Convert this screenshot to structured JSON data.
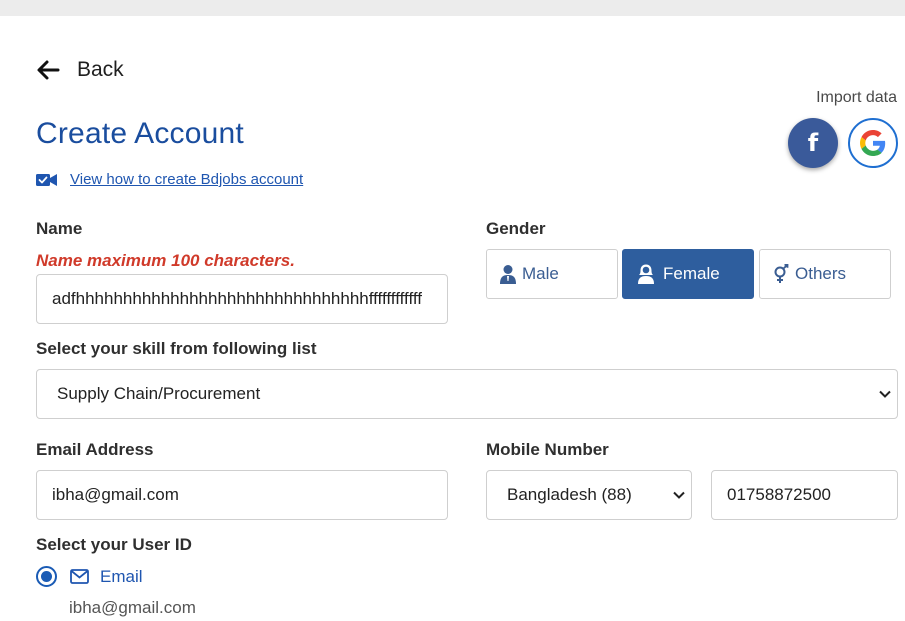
{
  "header": {
    "back_label": "Back",
    "title": "Create Account",
    "howto_link": "View how to create Bdjobs account"
  },
  "import": {
    "label": "Import data",
    "facebook_glyph": "f"
  },
  "name": {
    "label": "Name",
    "error": "Name maximum 100 characters.",
    "value": "adfhhhhhhhhhhhhhhhhhhhhhhhhhhhhhhhffffffffffff"
  },
  "gender": {
    "label": "Gender",
    "options": [
      {
        "label": "Male",
        "selected": false
      },
      {
        "label": "Female",
        "selected": true
      },
      {
        "label": "Others",
        "selected": false
      }
    ]
  },
  "skill": {
    "label": "Select your skill from following list",
    "value": "Supply Chain/Procurement"
  },
  "email": {
    "label": "Email Address",
    "value": "ibha@gmail.com"
  },
  "mobile": {
    "label": "Mobile Number",
    "country": "Bangladesh (88)",
    "number": "01758872500"
  },
  "user_id": {
    "label": "Select your User ID",
    "option_label": "Email",
    "option_value": "ibha@gmail.com"
  },
  "colors": {
    "accent": "#1a4d9e",
    "active_button": "#2e5e9e",
    "error": "#d03a2a",
    "facebook": "#3a5a9a"
  }
}
